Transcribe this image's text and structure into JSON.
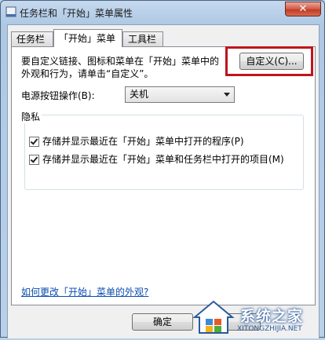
{
  "window": {
    "title": "任务栏和「开始」菜单属性",
    "close_label": "✕"
  },
  "tabs": [
    {
      "label": "任务栏",
      "active": false
    },
    {
      "label": "「开始」菜单",
      "active": true
    },
    {
      "label": "工具栏",
      "active": false
    }
  ],
  "start_menu": {
    "description_line1": "要自定义链接、图标和菜单在「开始」菜单中的",
    "description_line2": "外观和行为，请单击“自定义”。",
    "customize_button": "自定义(C)...",
    "power_label": "电源按钮操作(B):",
    "power_value": "关机"
  },
  "privacy": {
    "title": "隐私",
    "items": [
      {
        "label": "存储并显示最近在「开始」菜单中打开的程序(P)",
        "checked": true
      },
      {
        "label": "存储并显示最近在「开始」菜单和任务栏中打开的项目(M)",
        "checked": true
      }
    ]
  },
  "help_link": "如何更改「开始」菜单的外观?",
  "footer": {
    "ok_label": "确定",
    "cancel_label": ""
  },
  "watermark": {
    "text": "系统之家",
    "sub": "XITONGZHIJIA.NET"
  },
  "colors": {
    "highlight": "#c0141c",
    "link": "#0b4cb0"
  }
}
